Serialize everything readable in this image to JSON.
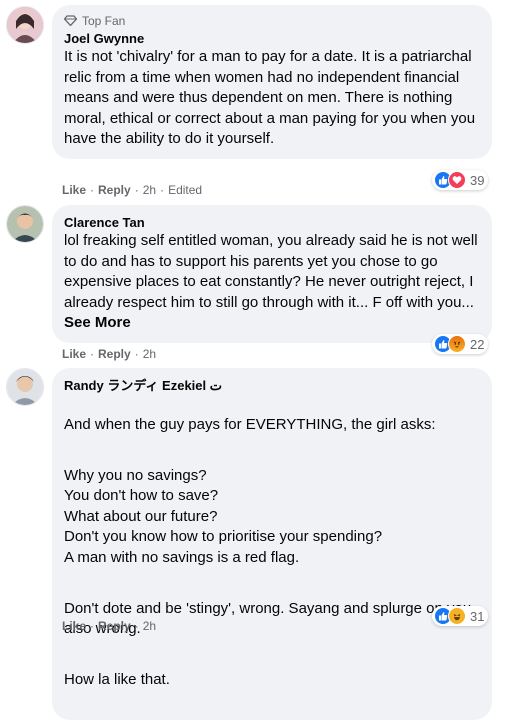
{
  "comments": [
    {
      "badge": "Top Fan",
      "author": "Joel Gwynne",
      "paragraphs": [
        "It is not 'chivalry' for a man to pay for a date. It is a patriarchal relic from a time when women had no independent financial means and were thus dependent on men. There is nothing moral, ethical or correct about a man paying for you when you have the ability to do it yourself."
      ],
      "actions": {
        "like": "Like",
        "reply": "Reply",
        "time": "2h",
        "edited": "Edited"
      },
      "reactions": {
        "icons": [
          "like-icon",
          "love-icon"
        ],
        "count": "39"
      },
      "colors": {
        "like": "#1877f2",
        "love": "#f33e58"
      }
    },
    {
      "author": "Clarence Tan",
      "paragraphs": [
        "lol freaking self entitled woman, you already said he is not well to do and has to support his parents yet you chose to go expensive places to eat constantly? He never outright reject, I already respect him to still go through with it... F off with you..."
      ],
      "see_more": "See More",
      "actions": {
        "like": "Like",
        "reply": "Reply",
        "time": "2h"
      },
      "reactions": {
        "icons": [
          "like-icon",
          "angry-icon"
        ],
        "count": "22"
      },
      "colors": {
        "like": "#1877f2",
        "angry": "#e9710f"
      }
    },
    {
      "author": "Randy ランディ Ezekiel ت",
      "paragraphs": [
        "And when the guy pays for EVERYTHING, the girl asks:",
        "Why you no savings?\nYou don't how to save?\nWhat about our future?\nDon't you know how to prioritise your spending?\nA man with no savings is a red flag.",
        "Don't dote and be 'stingy', wrong. Sayang and splurge on you, also wrong.",
        "How la like that."
      ],
      "actions": {
        "like": "Like",
        "reply": "Reply",
        "time": "2h"
      },
      "reactions": {
        "icons": [
          "like-icon",
          "haha-icon"
        ],
        "count": "31"
      },
      "colors": {
        "like": "#1877f2",
        "haha": "#f7b125"
      }
    }
  ]
}
